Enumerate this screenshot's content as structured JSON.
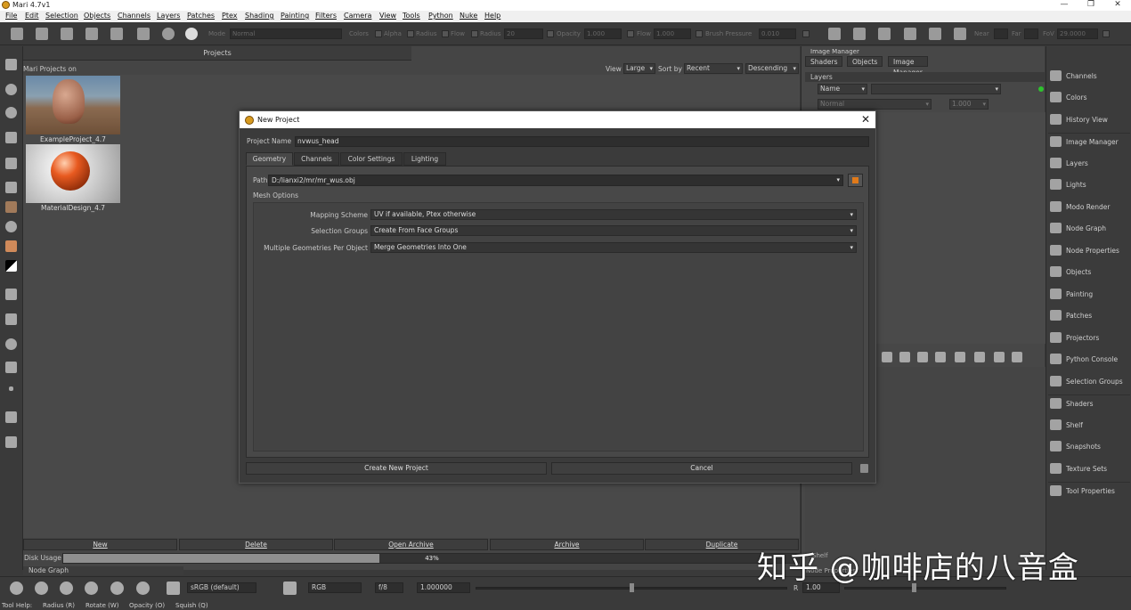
{
  "window": {
    "title": "Mari 4.7v1"
  },
  "menu": [
    "File",
    "Edit",
    "Selection",
    "Objects",
    "Channels",
    "Layers",
    "Patches",
    "Ptex",
    "Shading",
    "Painting",
    "Filters",
    "Camera",
    "View",
    "Tools",
    "Python",
    "Nuke",
    "Help"
  ],
  "toolbar": {
    "mode_label": "Mode",
    "mode_value": "Normal",
    "colors_label": "Colors",
    "alpha_label": "Alpha",
    "radius_check_label": "Radius",
    "flow_check_label": "Flow",
    "radius_label": "Radius",
    "radius_value": "20",
    "opacity_label": "Opacity",
    "opacity_value": "1.000",
    "flow_label": "Flow",
    "flow_value": "1.000",
    "pressure_label": "Brush Pressure",
    "pressure_value": "0.010",
    "near_label": "Near",
    "far_label": "Far",
    "fov_label": "FoV",
    "fov_value": "29.0000"
  },
  "projects": {
    "tab_label": "Projects",
    "header_title": "Mari Projects on",
    "view_label": "View",
    "view_value": "Large",
    "sort_label": "Sort by",
    "sort_value": "Recent",
    "order_value": "Descending",
    "items": [
      {
        "name": "ExampleProject_4.7"
      },
      {
        "name": "MaterialDesign_4.7"
      }
    ],
    "actions": [
      "New",
      "Delete",
      "Open Archive",
      "Archive",
      "Duplicate"
    ],
    "disk_label": "Disk Usage",
    "disk_percent_text": "43%",
    "disk_fraction": 0.43,
    "node_graph_tab": "Node Graph"
  },
  "right_panel": {
    "title": "Image Manager",
    "tabs": [
      "Shaders",
      "Objects",
      "Image Manager"
    ],
    "layers_header": "Layers",
    "filter_value": "Name",
    "blend_value": "Normal",
    "blend_opacity": "1.000"
  },
  "dock": [
    "Channels",
    "Colors",
    "History View",
    "Image Manager",
    "Layers",
    "Lights",
    "Modo Render",
    "Node Graph",
    "Node Properties",
    "Objects",
    "Painting",
    "Patches",
    "Projectors",
    "Python Console",
    "Selection Groups",
    "Shaders",
    "Shelf",
    "Snapshots",
    "Texture Sets",
    "Tool Properties"
  ],
  "bottom_toolbar": {
    "colorspace": "sRGB (default)",
    "channel": "RGB",
    "fstop": "f/8",
    "exposure": "1.000000",
    "r_label": "R",
    "r_value": "1.00",
    "behind_tabs": [
      "Shelf",
      "Node Properties"
    ]
  },
  "status": {
    "tool_help": "Tool Help:",
    "hints": [
      "Radius (R)",
      "Rotate (W)",
      "Opacity (O)",
      "Squish (Q)"
    ]
  },
  "watermark": "知乎 @咖啡店的八音盒",
  "dialog": {
    "title": "New Project",
    "project_name_label": "Project Name",
    "project_name_value": "nvwus_head",
    "tabs": [
      "Geometry",
      "Channels",
      "Color Settings",
      "Lighting"
    ],
    "path_label": "Path",
    "path_value": "D:/lianxi2/mr/mr_wus.obj",
    "mesh_options_label": "Mesh Options",
    "options": [
      {
        "label": "Mapping Scheme",
        "value": "UV if available, Ptex otherwise"
      },
      {
        "label": "Selection Groups",
        "value": "Create From Face Groups"
      },
      {
        "label": "Multiple Geometries Per Object",
        "value": "Merge Geometries Into One"
      }
    ],
    "create_button": "Create New Project",
    "cancel_button": "Cancel"
  },
  "colors": {
    "app_icon": "#d79a1f",
    "accent_orange": "#e07a1a",
    "status_green": "#2ec22e"
  }
}
